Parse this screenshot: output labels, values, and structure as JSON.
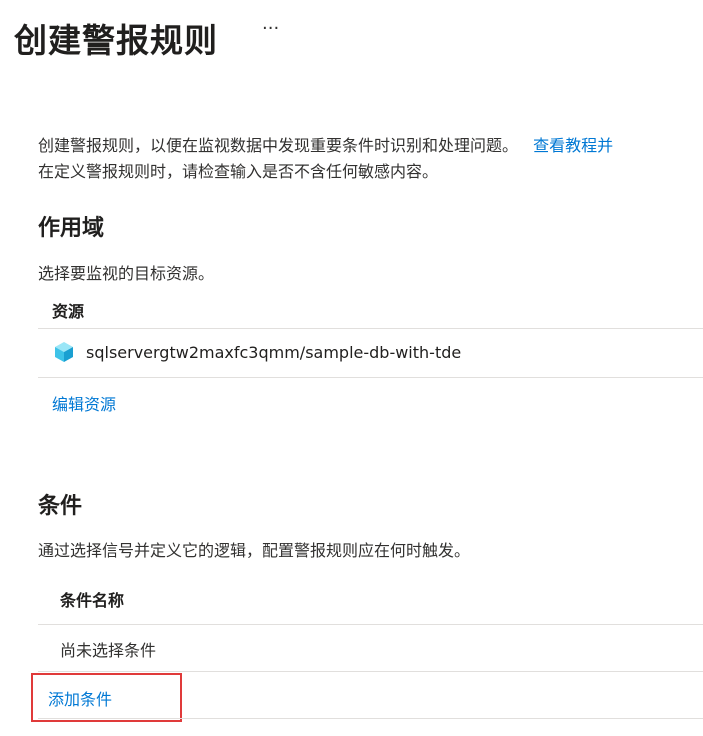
{
  "header": {
    "title": "创建警报规则",
    "more_label": "···"
  },
  "intro": {
    "line1": "创建警报规则，以便在监视数据中发现重要条件时识别和处理问题。",
    "link": "查看教程并",
    "line2": "在定义警报规则时，请检查输入是否不含任何敏感内容。"
  },
  "scope": {
    "heading": "作用域",
    "subtitle": "选择要监视的目标资源。",
    "column_header": "资源",
    "resource": "sqlservergtw2maxfc3qmm/sample-db-with-tde",
    "edit_link": "编辑资源"
  },
  "condition": {
    "heading": "条件",
    "subtitle": "通过选择信号并定义它的逻辑，配置警报规则应在何时触发。",
    "column_header": "条件名称",
    "empty_row": "尚未选择条件",
    "add_link": "添加条件"
  },
  "colors": {
    "accent": "#0078d4",
    "highlight": "#e03a3a",
    "divider": "#e1dfdd"
  },
  "icons": {
    "resource": "sql-database-cube-icon"
  }
}
